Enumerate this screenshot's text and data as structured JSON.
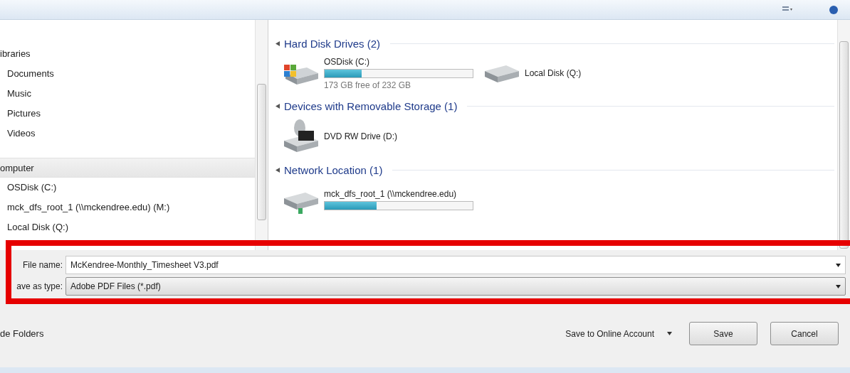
{
  "nav": [
    {
      "label": "ibraries",
      "selected": false,
      "children": [
        {
          "label": "Documents",
          "selected": false
        },
        {
          "label": "Music",
          "selected": false
        },
        {
          "label": "Pictures",
          "selected": false
        },
        {
          "label": "Videos",
          "selected": false
        }
      ]
    },
    {
      "label": "omputer",
      "selected": true,
      "children": [
        {
          "label": "OSDisk (C:)",
          "selected": false
        },
        {
          "label": "mck_dfs_root_1 (\\\\mckendree.edu) (M:)",
          "selected": false
        },
        {
          "label": "Local Disk (Q:)",
          "selected": false
        }
      ]
    }
  ],
  "sections": [
    {
      "title": "Hard Disk Drives (2)",
      "items": [
        {
          "kind": "system",
          "name": "OSDisk (C:)",
          "level": 0.25,
          "caption": "173 GB free of 232 GB"
        },
        {
          "kind": "disk",
          "name": "Local Disk (Q:)"
        }
      ]
    },
    {
      "title": "Devices with Removable Storage (1)",
      "items": [
        {
          "kind": "dvd",
          "name": "DVD RW Drive (D:)"
        }
      ]
    },
    {
      "title": "Network Location (1)",
      "items": [
        {
          "kind": "network",
          "name": "mck_dfs_root_1 (\\\\mckendree.edu)",
          "level": 0.35
        }
      ]
    }
  ],
  "form": {
    "file_name": {
      "label": "File name:",
      "value": "McKendree-Monthly_Timesheet V3.pdf"
    },
    "save_type": {
      "label": "ave as type:",
      "value": "Adobe PDF Files (*.pdf)"
    }
  },
  "footer": {
    "hide_folders": "de Folders",
    "online_account": "Save to Online Account",
    "buttons": [
      "Save",
      "Cancel"
    ]
  }
}
